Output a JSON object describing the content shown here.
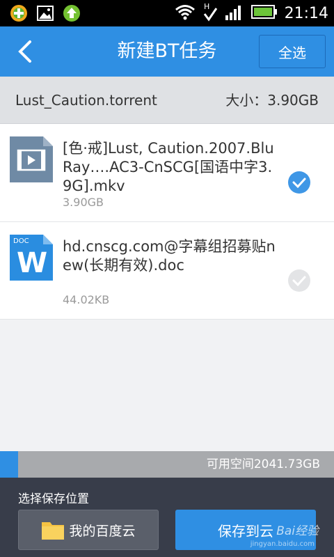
{
  "status_bar": {
    "time": "21:14",
    "left_icons": [
      "app-360-icon",
      "gallery-icon",
      "upload-arrow-icon"
    ],
    "right_icons": [
      "wifi-icon",
      "signal-icon",
      "battery-icon"
    ]
  },
  "app_bar": {
    "title": "新建BT任务",
    "select_all_label": "全选"
  },
  "torrent": {
    "name": "Lust_Caution.torrent",
    "size_label": "大小：3.90GB"
  },
  "files": [
    {
      "name": "[色·戒]Lust, Caution.2007.BluRay….AC3-CnSCG[国语中字3.9G].mkv",
      "size": "3.90GB",
      "type": "video",
      "checked": true
    },
    {
      "name": "hd.cnscg.com@字幕组招募贴new(长期有效).doc",
      "size": "44.02KB",
      "type": "doc",
      "icon_label": "DOC",
      "icon_letter": "W",
      "checked": false
    }
  ],
  "storage": {
    "available_label": "可用空间2041.73GB",
    "used_fraction": 0.055
  },
  "bottom": {
    "label": "选择保存位置",
    "location_button": "我的百度云",
    "save_button": "保存到云",
    "watermark": "Bai经验",
    "watermark_sub": "jingyan.baidu.com"
  },
  "colors": {
    "accent": "#2f8fe3",
    "bottom_panel": "#383d4a"
  }
}
